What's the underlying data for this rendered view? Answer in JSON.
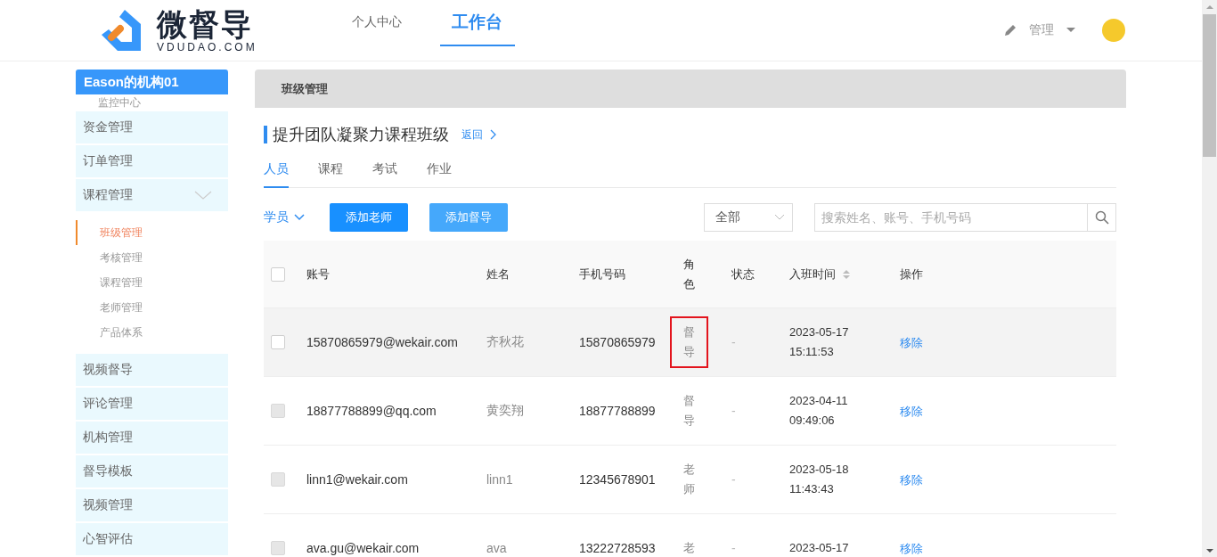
{
  "header": {
    "logo_text": "微督导",
    "logo_sub": "VDUDAO.COM",
    "nav": [
      {
        "label": "个人中心",
        "selected": false
      },
      {
        "label": "工作台",
        "selected": true
      }
    ],
    "user_menu": "管理"
  },
  "sidebar": {
    "org": "Eason的机构01",
    "items": [
      {
        "kind": "link",
        "label": "监控中心"
      },
      {
        "kind": "group",
        "label": "资金管理"
      },
      {
        "kind": "group",
        "label": "订单管理"
      },
      {
        "kind": "group",
        "label": "课程管理",
        "expanded": true,
        "children": [
          {
            "label": "班级管理",
            "selected": true
          },
          {
            "label": "考核管理",
            "selected": false
          },
          {
            "label": "课程管理",
            "selected": false
          },
          {
            "label": "老师管理",
            "selected": false
          },
          {
            "label": "产品体系",
            "selected": false
          }
        ]
      },
      {
        "kind": "group",
        "label": "视频督导"
      },
      {
        "kind": "group",
        "label": "评论管理"
      },
      {
        "kind": "group",
        "label": "机构管理"
      },
      {
        "kind": "group",
        "label": "督导模板"
      },
      {
        "kind": "group",
        "label": "视频管理"
      },
      {
        "kind": "group",
        "label": "心智评估"
      }
    ]
  },
  "breadcrumb": "班级管理",
  "class_title": "提升团队凝聚力课程班级",
  "back_link": "返回",
  "tabs": [
    {
      "label": "人员",
      "selected": true
    },
    {
      "label": "课程",
      "selected": false
    },
    {
      "label": "考试",
      "selected": false
    },
    {
      "label": "作业",
      "selected": false
    }
  ],
  "toolbar": {
    "role_filter": "学员",
    "buttons": [
      {
        "label": "添加老师",
        "kind": "primary"
      },
      {
        "label": "添加督导",
        "kind": "light"
      }
    ],
    "status_select": "全部",
    "search": {
      "placeholder": "搜索姓名、账号、手机号码"
    }
  },
  "table": {
    "select_all": {
      "checked": false
    },
    "columns": [
      "账号",
      "姓名",
      "手机号码",
      "角色",
      "状态",
      "入班时间",
      "操作"
    ],
    "rows": [
      {
        "account": "15870865979@wekair.com",
        "name": "齐秋花",
        "phone": "15870865979",
        "role": "督导",
        "status": "-",
        "date": "2023-05-17",
        "time": "15:11:53",
        "action": "移除",
        "highlighted": true,
        "role_marked": true,
        "checkbox_disabled": false
      },
      {
        "account": "18877788899@qq.com",
        "name": "黄奕翔",
        "phone": "18877788899",
        "role": "督导",
        "status": "-",
        "date": "2023-04-11",
        "time": "09:49:06",
        "action": "移除",
        "highlighted": false,
        "role_marked": false,
        "checkbox_disabled": true
      },
      {
        "account": "linn1@wekair.com",
        "name": "linn1",
        "phone": "12345678901",
        "role": "老师",
        "status": "-",
        "date": "2023-05-18",
        "time": "11:43:43",
        "action": "移除",
        "highlighted": false,
        "role_marked": false,
        "checkbox_disabled": true
      },
      {
        "account": "ava.gu@wekair.com",
        "name": "ava",
        "phone": "13222728593",
        "role": "老",
        "status": "-",
        "date": "2023-05-17",
        "time": "",
        "action": "移除",
        "highlighted": false,
        "role_marked": false,
        "checkbox_disabled": true
      }
    ]
  }
}
